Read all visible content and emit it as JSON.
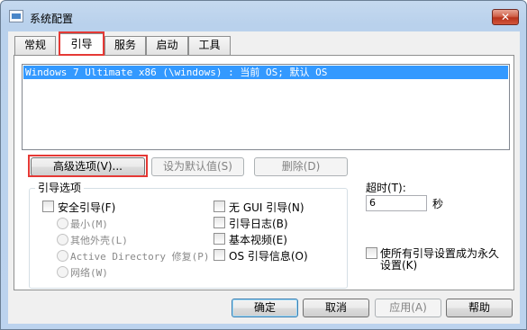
{
  "window": {
    "title": "系统配置",
    "close_label": "✕"
  },
  "tabs": [
    {
      "label": "常规",
      "active": false
    },
    {
      "label": "引导",
      "active": true
    },
    {
      "label": "服务",
      "active": false
    },
    {
      "label": "启动",
      "active": false
    },
    {
      "label": "工具",
      "active": false
    }
  ],
  "os_list": {
    "items": [
      "Windows 7 Ultimate x86 (\\windows) : 当前 OS; 默认 OS"
    ]
  },
  "action_buttons": {
    "advanced": "高级选项(V)...",
    "set_default": "设为默认值(S)",
    "delete": "删除(D)"
  },
  "boot_options": {
    "title": "引导选项",
    "safe_boot": "安全引导(F)",
    "minimal": "最小(M)",
    "alternate_shell": "其他外壳(L)",
    "active_directory": "Active Directory 修复(P)",
    "network": "网络(W)",
    "no_gui": "无 GUI 引导(N)",
    "boot_log": "引导日志(B)",
    "base_video": "基本视频(E)",
    "os_boot_info": "OS 引导信息(O)"
  },
  "timeout": {
    "label": "超时(T):",
    "value": "6",
    "unit": "秒"
  },
  "make_permanent": {
    "line1": "使所有引导设置成为永久",
    "line2": "设置(K)"
  },
  "footer": {
    "ok": "确定",
    "cancel": "取消",
    "apply": "应用(A)",
    "help": "帮助"
  },
  "colors": {
    "selection": "#3399ff",
    "highlight_box": "#e53935"
  }
}
